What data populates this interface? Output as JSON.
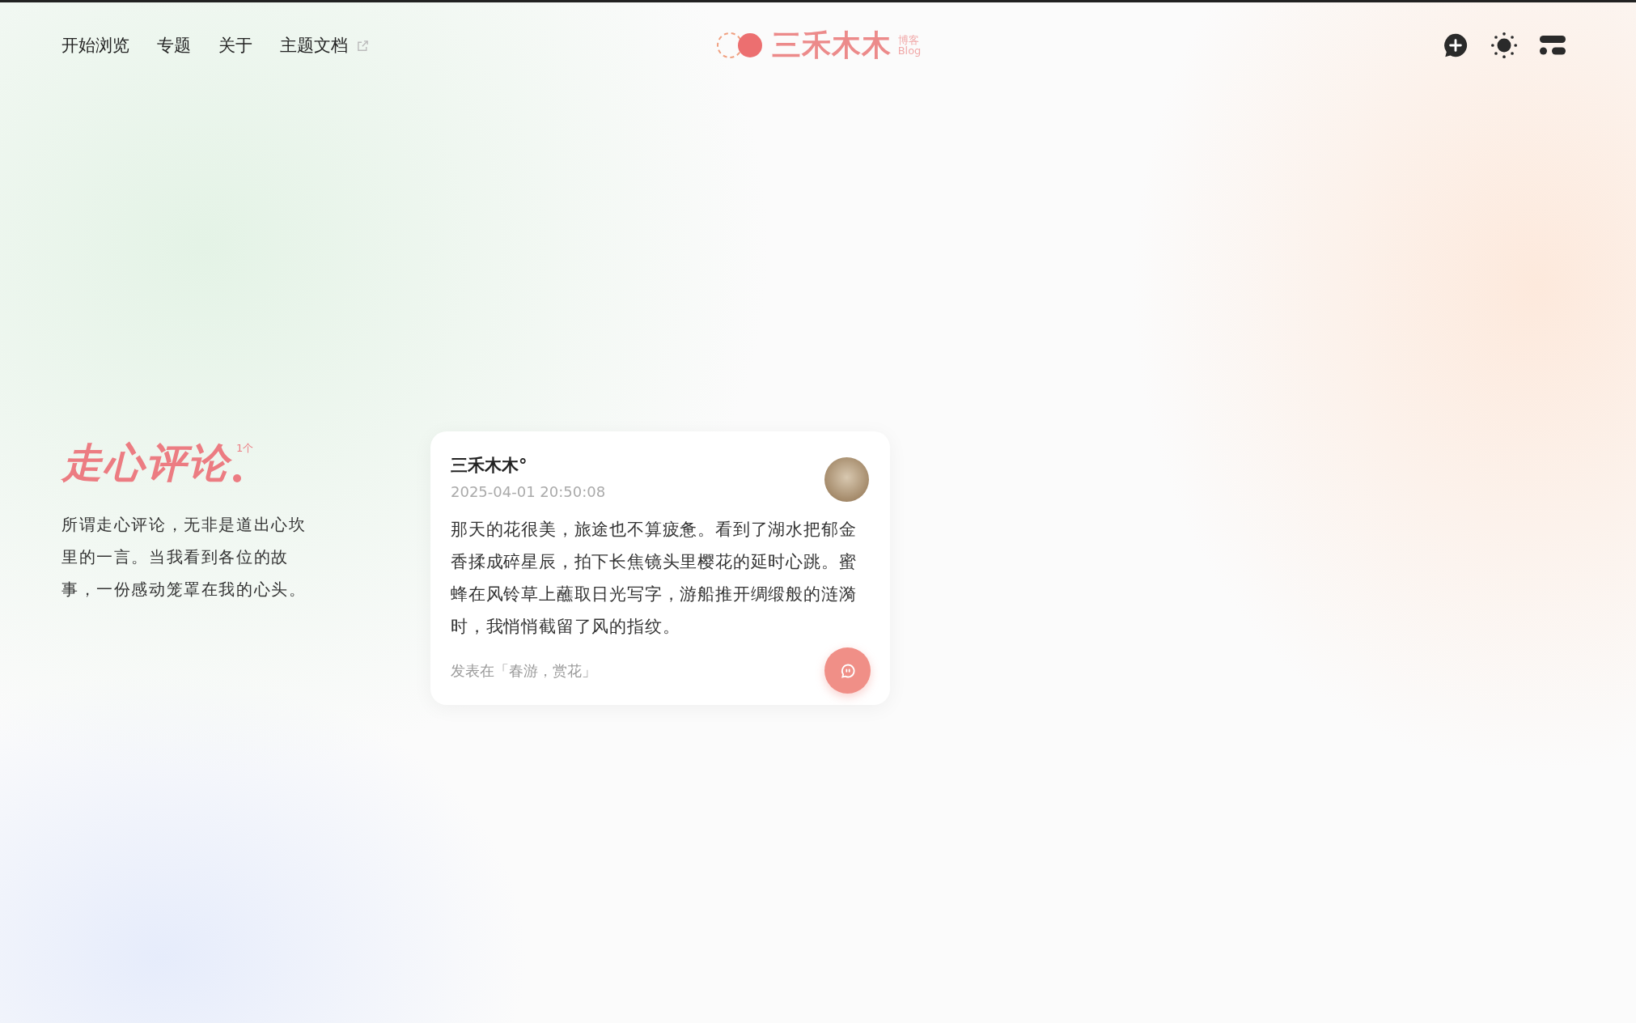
{
  "nav": {
    "links": [
      {
        "label": "开始浏览",
        "external": false
      },
      {
        "label": "专题",
        "external": false
      },
      {
        "label": "关于",
        "external": false
      },
      {
        "label": "主题文档",
        "external": true
      }
    ]
  },
  "logo": {
    "name": "三禾木木",
    "tag_cn": "博客",
    "tag_en": "Blog"
  },
  "section": {
    "title": "走心评论",
    "count": "1个",
    "description": "所谓走心评论，无非是道出心坎里的一言。当我看到各位的故事，一份感动笼罩在我的心头。"
  },
  "comments": [
    {
      "author": "三禾木木°",
      "time": "2025-04-01 20:50:08",
      "text": "那天的花很美，旅途也不算疲惫。看到了湖水把郁金香揉成碎星辰，拍下长焦镜头里樱花的延时心跳。蜜蜂在风铃草上蘸取日光写字，游船推开绸缎般的涟漪时，我悄悄截留了风的指纹。",
      "posted_in": "发表在「春游，赏花」"
    }
  ]
}
